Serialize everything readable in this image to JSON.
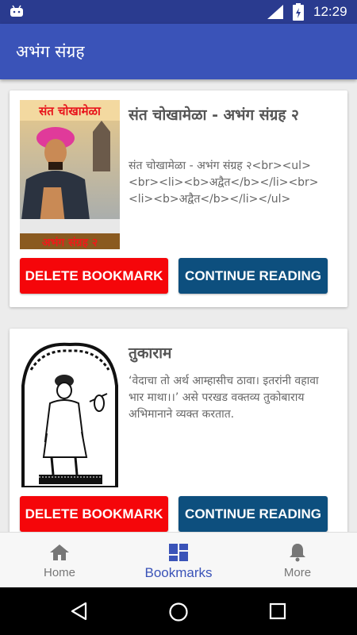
{
  "status_bar": {
    "time": "12:29",
    "icons": [
      "android-icon",
      "signal-icon",
      "battery-icon"
    ]
  },
  "app_bar": {
    "title": "अभंग संग्रह"
  },
  "bookmarks": [
    {
      "title": "संत चोखामेळा - अभंग संग्रह २",
      "description": "संत चोखामेळा - अभंग संग्रह २<br><ul><br><li><b>अद्वैत</b></li><br><li><b>अद्वैत</b></li></ul>",
      "cover_text_top": "संत चोखामेळा",
      "cover_text_bottom": "अभंग संग्रह २",
      "delete_label": "DELETE BOOKMARK",
      "continue_label": "CONTINUE READING"
    },
    {
      "title": "तुकाराम",
      "description": "‘वेदाचा तो अर्थ आम्हासीच ठावा। इतरांनी वहावा भार माथा।।’ असे परखड वक्तव्य तुकोबाराय अभिमानाने व्यक्त करतात.",
      "delete_label": "DELETE BOOKMARK",
      "continue_label": "CONTINUE READING"
    }
  ],
  "bottom_nav": [
    {
      "label": "Home",
      "icon": "home-icon",
      "active": false
    },
    {
      "label": "Bookmarks",
      "icon": "dashboard-icon",
      "active": true
    },
    {
      "label": "More",
      "icon": "bell-icon",
      "active": false
    }
  ],
  "colors": {
    "primary": "#3a53b8",
    "status_bar": "#2a3b8f",
    "delete": "#f5060a",
    "continue": "#0d4f7e"
  }
}
